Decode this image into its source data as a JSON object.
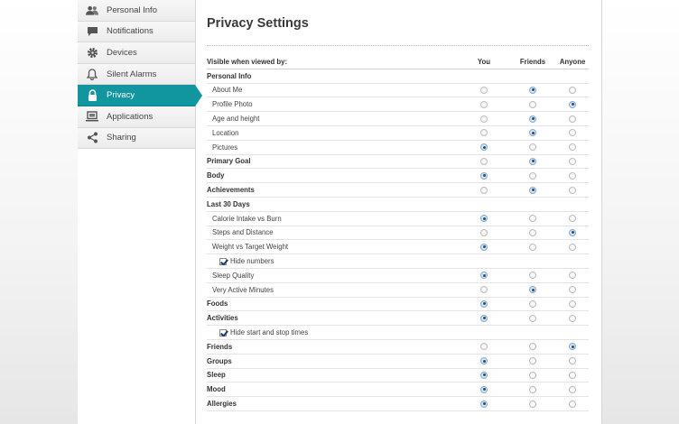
{
  "sidebar": {
    "items": [
      {
        "label": "Personal Info",
        "icon": "people-icon",
        "active": false
      },
      {
        "label": "Notifications",
        "icon": "speech-bubble-icon",
        "active": false
      },
      {
        "label": "Devices",
        "icon": "gear-icon",
        "active": false
      },
      {
        "label": "Silent Alarms",
        "icon": "bell-icon",
        "active": false
      },
      {
        "label": "Privacy",
        "icon": "lock-icon",
        "active": true
      },
      {
        "label": "Applications",
        "icon": "laptop-icon",
        "active": false
      },
      {
        "label": "Sharing",
        "icon": "share-icon",
        "active": false
      }
    ]
  },
  "main": {
    "title": "Privacy Settings",
    "header": {
      "label": "Visible when viewed by:",
      "you": "You",
      "friends": "Friends",
      "anyone": "Anyone"
    },
    "rows": [
      {
        "type": "section",
        "label": "Personal Info"
      },
      {
        "type": "child",
        "label": "About Me",
        "selected": "friends"
      },
      {
        "type": "child",
        "label": "Profile Photo",
        "selected": "anyone"
      },
      {
        "type": "child",
        "label": "Age and height",
        "selected": "friends"
      },
      {
        "type": "child",
        "label": "Location",
        "selected": "friends"
      },
      {
        "type": "child",
        "label": "Pictures",
        "selected": "you"
      },
      {
        "type": "bold",
        "label": "Primary Goal",
        "selected": "friends"
      },
      {
        "type": "bold",
        "label": "Body",
        "selected": "you"
      },
      {
        "type": "bold",
        "label": "Achievements",
        "selected": "friends"
      },
      {
        "type": "section",
        "label": "Last 30 Days"
      },
      {
        "type": "child",
        "label": "Calorie Intake vs Burn",
        "selected": "you"
      },
      {
        "type": "child",
        "label": "Steps and Distance",
        "selected": "anyone"
      },
      {
        "type": "child",
        "label": "Weight vs Target Weight",
        "selected": "you"
      },
      {
        "type": "check",
        "label": "Hide numbers",
        "checked": true
      },
      {
        "type": "child",
        "label": "Sleep Quality",
        "selected": "you"
      },
      {
        "type": "child",
        "label": "Very Active Minutes",
        "selected": "friends"
      },
      {
        "type": "bold",
        "label": "Foods",
        "selected": "you"
      },
      {
        "type": "bold",
        "label": "Activities",
        "selected": "you"
      },
      {
        "type": "check",
        "label": "Hide start and stop times",
        "checked": true
      },
      {
        "type": "bold",
        "label": "Friends",
        "selected": "anyone"
      },
      {
        "type": "bold",
        "label": "Groups",
        "selected": "you"
      },
      {
        "type": "bold",
        "label": "Sleep",
        "selected": "you"
      },
      {
        "type": "bold",
        "label": "Mood",
        "selected": "you"
      },
      {
        "type": "bold",
        "label": "Allergies",
        "selected": "you"
      }
    ]
  },
  "colors": {
    "accent": "#11959e",
    "radio_selected": "#1d4f86"
  }
}
